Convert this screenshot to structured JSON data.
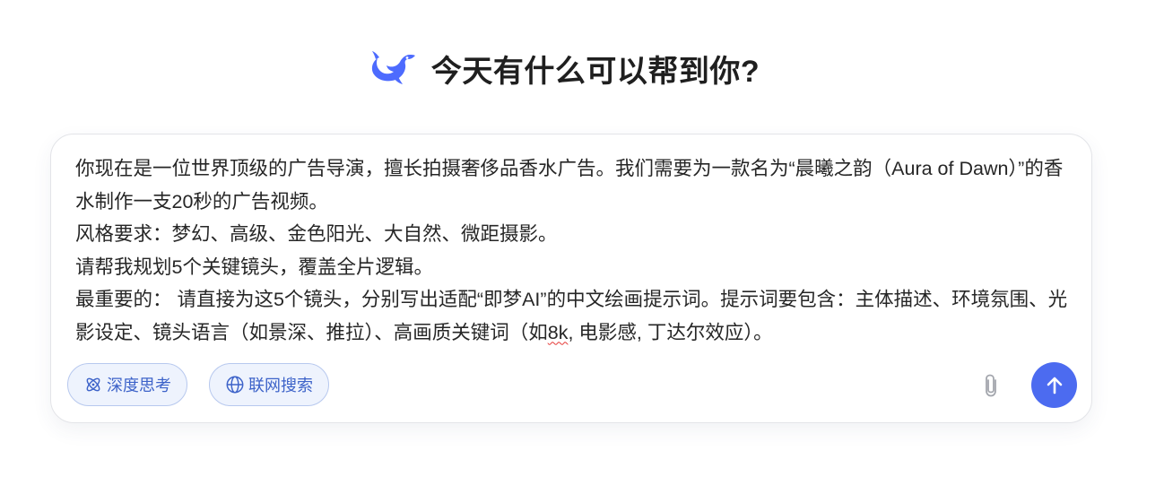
{
  "header": {
    "logo_icon": "whale-logo-icon",
    "title": "今天有什么可以帮到你?"
  },
  "composer": {
    "prompt_before_spell": "你现在是一位世界顶级的广告导演，擅长拍摄奢侈品香水广告。我们需要为一款名为“晨曦之韵（Aura of Dawn）”的香水制作一支20秒的广告视频。\n风格要求：梦幻、高级、金色阳光、大自然、微距摄影。\n请帮我规划5个关键镜头，覆盖全片逻辑。\n最重要的： 请直接为这5个镜头，分别写出适配“即梦AI”的中文绘画提示词。提示词要包含：主体描述、环境氛围、光影设定、镜头语言（如景深、推拉）、高画质关键词（如",
    "prompt_spell_word": "8k",
    "prompt_after_spell": ", 电影感, 丁达尔效应）。",
    "chips": {
      "deep_think": {
        "label": "深度思考",
        "icon": "atom-icon"
      },
      "web_search": {
        "label": "联网搜索",
        "icon": "globe-icon"
      }
    },
    "attach_icon": "paperclip-icon",
    "send_icon": "arrow-up-icon"
  },
  "colors": {
    "accent": "#4c6bf0",
    "chip_text": "#3d63c9",
    "chip_bg": "#eef3fd",
    "chip_border": "#b7c8ee",
    "title": "#1f1f1f",
    "body_text": "#262626"
  }
}
